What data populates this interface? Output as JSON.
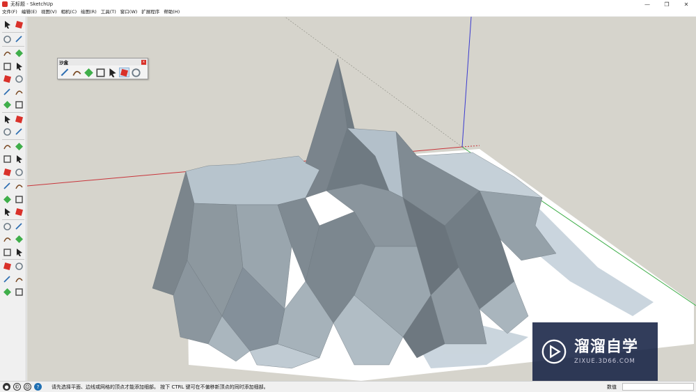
{
  "window": {
    "title": "无标题 - SketchUp",
    "minimize_glyph": "—",
    "restore_glyph": "❐",
    "close_glyph": "✕"
  },
  "menu": [
    "文件(F)",
    "编辑(E)",
    "视图(V)",
    "相机(C)",
    "绘图(R)",
    "工具(T)",
    "窗口(W)",
    "扩展程序",
    "帮助(H)"
  ],
  "left_toolbar": {
    "tools": [
      "select-icon",
      "component-icon",
      "paint-bucket-icon",
      "eraser-icon",
      "pencil-line-icon",
      "freehand-icon",
      "rectangle-icon",
      "rotated-rectangle-icon",
      "circle-icon",
      "polygon-icon",
      "arc-icon",
      "two-point-arc-icon",
      "three-point-arc-icon",
      "pie-icon",
      "move-icon",
      "push-pull-icon",
      "rotate-icon",
      "follow-me-icon",
      "scale-icon",
      "offset-icon",
      "tape-measure-icon",
      "dimension-icon",
      "protractor-icon",
      "text-icon",
      "axes-icon",
      "3d-text-icon",
      "orbit-icon",
      "pan-icon",
      "zoom-icon",
      "zoom-window-icon",
      "zoom-extents-icon",
      "previous-view-icon",
      "position-camera-icon",
      "look-around-icon",
      "walk-icon",
      "section-plane-icon",
      "warehouse-icon",
      "extension-warehouse-icon",
      "layout-icon",
      "extension-manager-icon",
      "house-icon",
      "share-icon"
    ]
  },
  "sandbox_toolbar": {
    "title": "沙盒",
    "close_glyph": "x",
    "tools": [
      "from-contours-icon",
      "from-scratch-icon",
      "smoove-icon",
      "stamp-icon",
      "drape-icon",
      "add-detail-icon",
      "flip-edge-icon"
    ],
    "active_tool_index": 5
  },
  "status": {
    "message": "请先选择平面、边线或网格的顶点才能添加细部。 按下 CTRL 键可在不偏移新顶点的同时添加细部。",
    "vcb_label": "数值",
    "vcb_value": "",
    "info_glyph": "?"
  },
  "watermark": {
    "brand": "溜溜自学",
    "site": "ZIXUE.3D66.COM"
  },
  "colors": {
    "viewport_bg": "#d6d4cc",
    "terrain_face": "#7f8a92",
    "terrain_light": "#b9c6cf",
    "ground": "#ffffff",
    "axis_red": "#c8343a",
    "axis_green": "#3fae4a",
    "axis_blue": "#3a3ad0",
    "accent": "#d9312a"
  }
}
